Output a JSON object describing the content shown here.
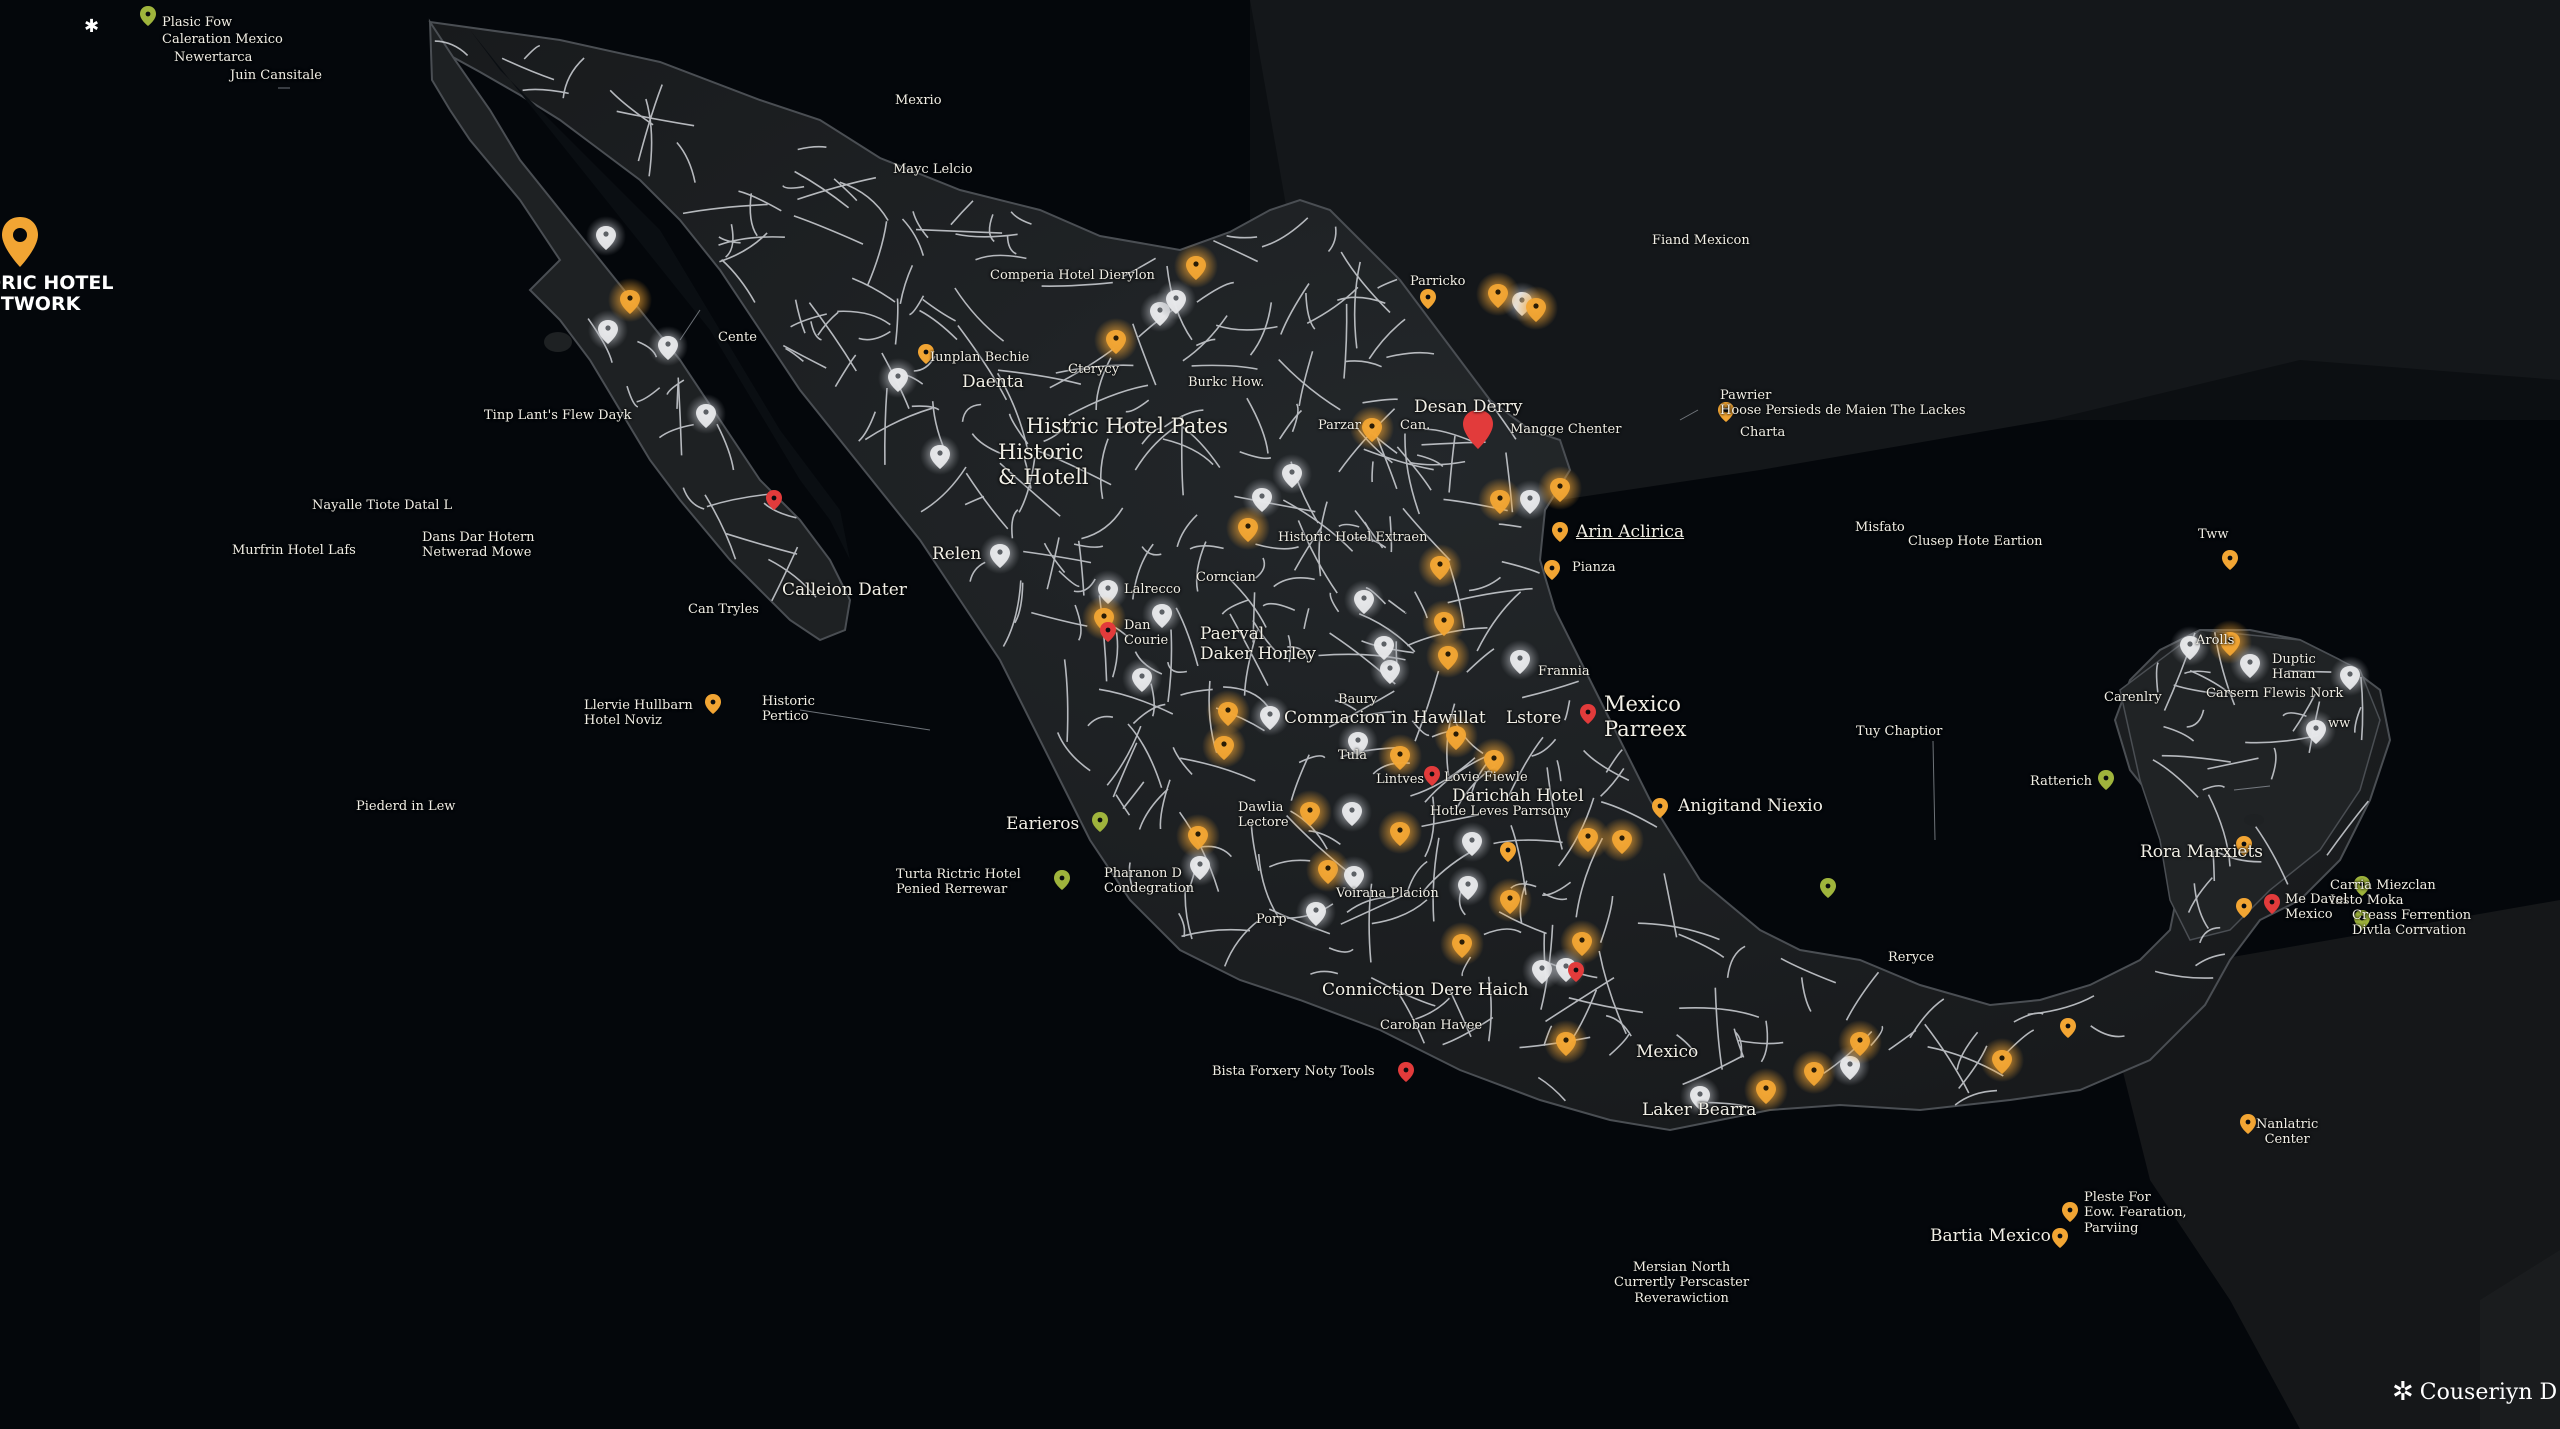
{
  "map": {
    "brand": {
      "title_line1": "TORIC HOTEL",
      "title_line2": "NETWORK",
      "pin_icon": "map-pin-icon"
    },
    "credit": {
      "text": "Couseriyn D",
      "icon": "asterisk-logo-icon"
    },
    "colors": {
      "ocean": "#04070b",
      "land": "#1c1f21",
      "roads": "#e6e9ee",
      "hotel_gold": "#f2a533",
      "hotel_glow": "#c8cbd1",
      "accent_red": "#e23b3b",
      "accent_green": "#9fb43c"
    },
    "labels": {
      "tl1": "Plasic Fow",
      "tl2": "Caleration Mexico",
      "tl3": "Newertarca",
      "tl4": "Juin Cansitale",
      "mexrio": "Mexrio",
      "mayc": "Mayc Lelcio",
      "comperia": "Comperia Hotel Dierylon",
      "parricko": "Parricko",
      "fiand": "Fiand Mexicon",
      "cente": "Cente",
      "iunplan": "Iunplan Bechie",
      "daenta": "Daenta",
      "cterycy": "Cterycy",
      "burkc": "Burkc How.",
      "tinp": "Tinp Lant's Flew Dayk",
      "histric": "Histric Hotel Pates",
      "historic_hotell": "Historic\n& Hotell",
      "desan": "Desan Derry",
      "parzar": "Parzar",
      "can": "Can.",
      "mangge": "Mangge Chenter",
      "pawrier": "Pawrier\nHoose Persieds de Maien The Lackes",
      "charta": "Charta",
      "nayalle": "Nayalle Tiote Datal L",
      "dans": "Dans Dar Hotern\nNetwerad Mowe",
      "murfrin": "Murfrin Hotel Lafs",
      "relen": "Relen",
      "hist_extr": "Historic Hotel Extraen",
      "arin": "Arin Aclirica",
      "misfato": "Misfato",
      "clusep": "Clusep Hote Eartion",
      "tww": "Tww",
      "pianza": "Pianza",
      "calleion": "Calleion Dater",
      "can_tryles": "Can Tryles",
      "lalrecco": "Lalrecco",
      "corncian": "Corncian",
      "dan_courie": "Dan\nCourie",
      "paerval": "Paerval\nDaker Horley",
      "frannia": "Frannia",
      "mexico_parreex": "Mexico\nParreex",
      "arolls": "Arolls",
      "duptic": "Duptic\nHanan",
      "carenlry": "Carenlry",
      "carsern": "Carsern Flewis Nork",
      "ww": "ww",
      "llervie": "Llervie Hullbarn\nHotel Noviz",
      "historic_pertico": "Historic\nPertico",
      "baury": "Baury",
      "commacion": "Commacion in Hawillat",
      "lstore": "Lstore",
      "tuy": "Tuy Chaptior",
      "tula": "Tula",
      "lovie": "Lovie Fiewle",
      "darichah": "Darichah Hotel",
      "lintves": "Lintves",
      "hotle": "Hotle Leves Parrsony",
      "ratterich": "Ratterich",
      "pieders": "Piederd in Lew",
      "earieros": "Earieros",
      "dawlia": "Dawlia\nLectore",
      "anigitand": "Anigitand Niexio",
      "rora": "Rora Marxiets",
      "turta": "Turta Rictric Hotel\nPenied Rerrewar",
      "pharanon": "Pharanon D\nCondegration",
      "voirana": "Voirana Placion",
      "carria": "Carria Miezclan\nIasto Moka",
      "me_davel": "Me Davel\nMexico",
      "creass": "Creass Ferrention\nDivtla Corrvation",
      "porp": "Porp",
      "reryce": "Reryce",
      "connicction": "Connicction Dere Haich",
      "caroban": "Caroban Havee",
      "mexico": "Mexico",
      "bista": "Bista Forxery Noty Tools",
      "laker": "Laker Bearra",
      "nanlatric": "Nanlatric\nCenter",
      "pleste": "Pleste For\nEow. Fearation,\nParviing",
      "bartia": "Bartia Mexico",
      "mersian": "Mersian North\nCurrertly Perscaster\nReverawiction"
    }
  }
}
